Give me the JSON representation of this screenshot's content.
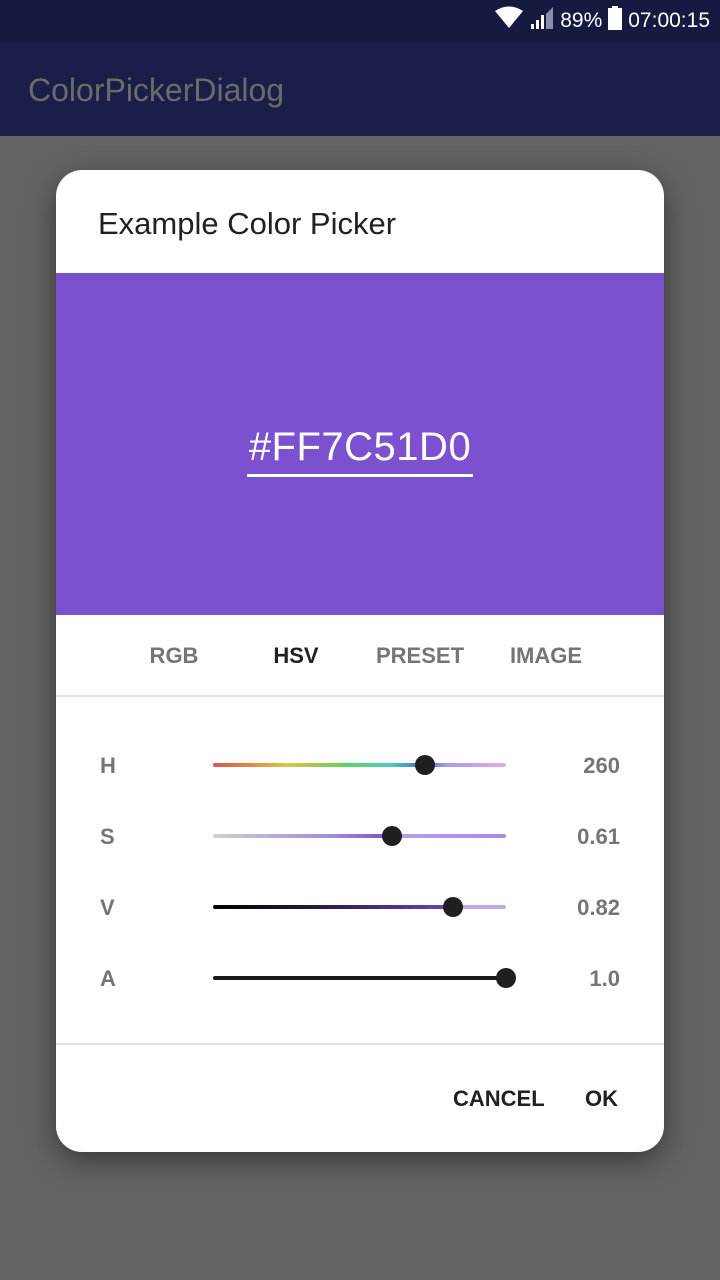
{
  "status_bar": {
    "battery_percent": "89%",
    "time": "07:00:15",
    "icons": [
      "wifi-icon",
      "cellular-signal-icon",
      "battery-icon"
    ]
  },
  "app_bar": {
    "title": "ColorPickerDialog"
  },
  "dialog": {
    "title": "Example Color Picker",
    "color_hex": "#FF7C51D0",
    "preview_color": "#7C51D0",
    "tabs": [
      {
        "label": "RGB",
        "active": false
      },
      {
        "label": "HSV",
        "active": true
      },
      {
        "label": "PRESET",
        "active": false
      },
      {
        "label": "IMAGE",
        "active": false
      }
    ],
    "sliders": [
      {
        "label": "H",
        "value": "260",
        "fraction": 0.722
      },
      {
        "label": "S",
        "value": "0.61",
        "fraction": 0.61
      },
      {
        "label": "V",
        "value": "0.82",
        "fraction": 0.82
      },
      {
        "label": "A",
        "value": "1.0",
        "fraction": 1.0
      }
    ],
    "buttons": {
      "cancel": "CANCEL",
      "ok": "OK"
    }
  }
}
